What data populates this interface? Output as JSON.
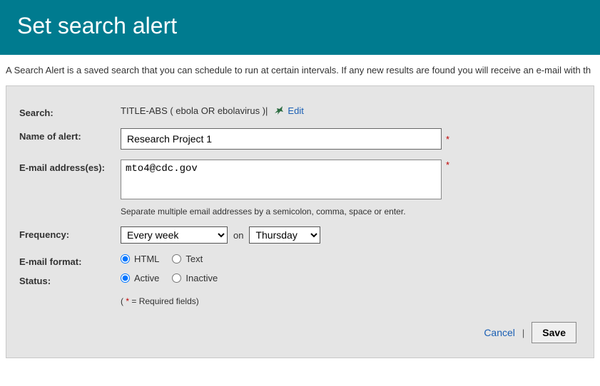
{
  "header": {
    "title": "Set search alert"
  },
  "description": "A Search Alert is a saved search that you can schedule to run at certain intervals. If any new results are found you will receive an e-mail with th",
  "labels": {
    "search": "Search:",
    "name": "Name of alert:",
    "email": "E-mail address(es):",
    "frequency": "Frequency:",
    "format": "E-mail format:",
    "status": "Status:"
  },
  "search": {
    "query": "TITLE-ABS ( ebola  OR  ebolavirus )",
    "sep": "  |",
    "edit_label": "Edit"
  },
  "name_value": "Research Project 1",
  "email_value": "mto4@cdc.gov",
  "email_helper": "Separate multiple email addresses by a semicolon, comma, space or enter.",
  "frequency": {
    "interval_selected": "Every week",
    "on_label": "on",
    "day_selected": "Thursday"
  },
  "format_options": {
    "html": "HTML",
    "text": "Text",
    "selected": "HTML"
  },
  "status_options": {
    "active": "Active",
    "inactive": "Inactive",
    "selected": "Active"
  },
  "required_note": {
    "open": "( ",
    "star": "*",
    "text": " = Required fields)"
  },
  "actions": {
    "cancel": "Cancel",
    "sep": "|",
    "save": "Save"
  },
  "required_mark": "*"
}
